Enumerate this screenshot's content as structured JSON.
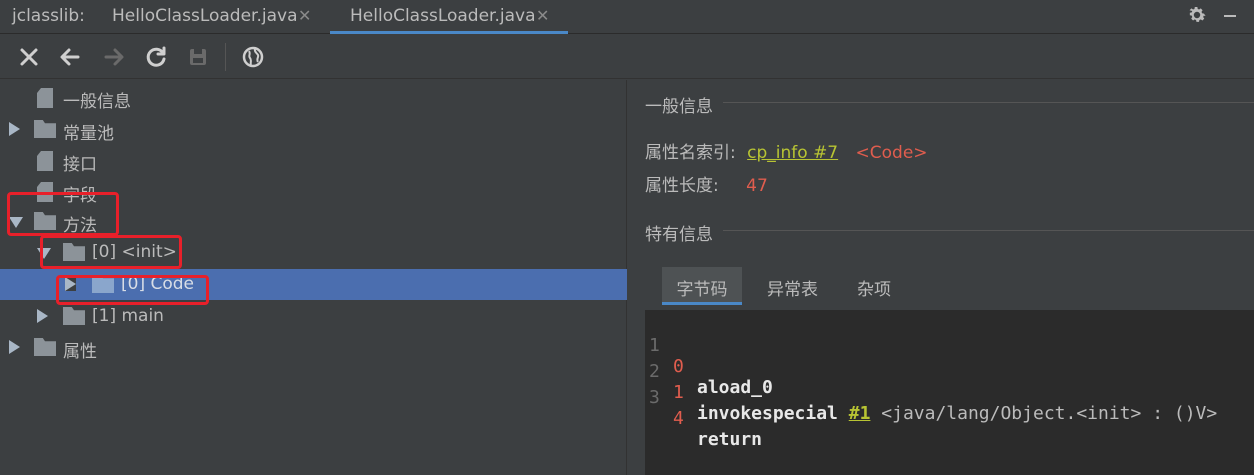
{
  "tabbar": {
    "prefix": "jclasslib:",
    "tabs": [
      {
        "label": "HelloClassLoader.java",
        "close": "✕"
      },
      {
        "label": "HelloClassLoader.java",
        "close": "✕"
      }
    ],
    "accent": "#4a88c7"
  },
  "toolbar": {
    "icons": [
      "close-icon",
      "back-arrow-icon",
      "forward-arrow-icon",
      "refresh-icon",
      "save-icon",
      "globe-icon"
    ]
  },
  "tree": {
    "items": [
      {
        "label": "一般信息",
        "icon": "document-icon",
        "expander": "none"
      },
      {
        "label": "常量池",
        "icon": "folder-icon",
        "expander": "collapsed"
      },
      {
        "label": "接口",
        "icon": "document-icon",
        "expander": "none"
      },
      {
        "label": "字段",
        "icon": "document-icon",
        "expander": "none"
      },
      {
        "label": "方法",
        "icon": "folder-icon",
        "expander": "expanded"
      },
      {
        "label": "[0] <init>",
        "icon": "folder-icon",
        "expander": "expanded"
      },
      {
        "label": "[0] Code",
        "icon": "folder-icon",
        "expander": "collapsed",
        "selected": true
      },
      {
        "label": "[1] main",
        "icon": "folder-icon",
        "expander": "collapsed"
      },
      {
        "label": "属性",
        "icon": "folder-icon",
        "expander": "collapsed"
      }
    ],
    "highlight_color": "#e8202a"
  },
  "detail": {
    "general_title": "一般信息",
    "name_index_label": "属性名索引:",
    "name_index_link": "cp_info #7",
    "name_index_value": "<Code>",
    "length_label": "属性长度:",
    "length_value": "47",
    "specific_title": "特有信息",
    "subtabs": [
      "字节码",
      "异常表",
      "杂项"
    ],
    "active_subtab": "字节码"
  },
  "bytecode": [
    {
      "line": "1",
      "offset": "0",
      "op": "aload_0",
      "ref": "",
      "rest": ""
    },
    {
      "line": "2",
      "offset": "1",
      "op": "invokespecial",
      "ref": "#1",
      "rest": "<java/lang/Object.<init> : ()V>"
    },
    {
      "line": "3",
      "offset": "4",
      "op": "return",
      "ref": "",
      "rest": ""
    }
  ]
}
